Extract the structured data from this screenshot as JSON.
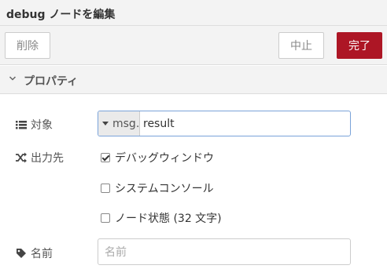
{
  "dialog": {
    "title": "debug ノードを編集"
  },
  "toolbar": {
    "delete_label": "削除",
    "cancel_label": "中止",
    "done_label": "完了"
  },
  "section": {
    "title": "プロパティ"
  },
  "target": {
    "label": "対象",
    "type_prefix": "msg.",
    "value": "result"
  },
  "output": {
    "label": "出力先",
    "options": [
      {
        "label": "デバッグウィンドウ",
        "checked": true
      },
      {
        "label": "システムコンソール",
        "checked": false
      },
      {
        "label": "ノード状態 (32 文字)",
        "checked": false
      }
    ]
  },
  "name": {
    "label": "名前",
    "placeholder": "名前"
  },
  "colors": {
    "accent": "#ad1625",
    "focus_border": "#7aa3d9"
  },
  "icons": {
    "target": "list-icon",
    "output": "shuffle-icon",
    "name": "tag-icon",
    "section": "chevron-down-icon"
  }
}
